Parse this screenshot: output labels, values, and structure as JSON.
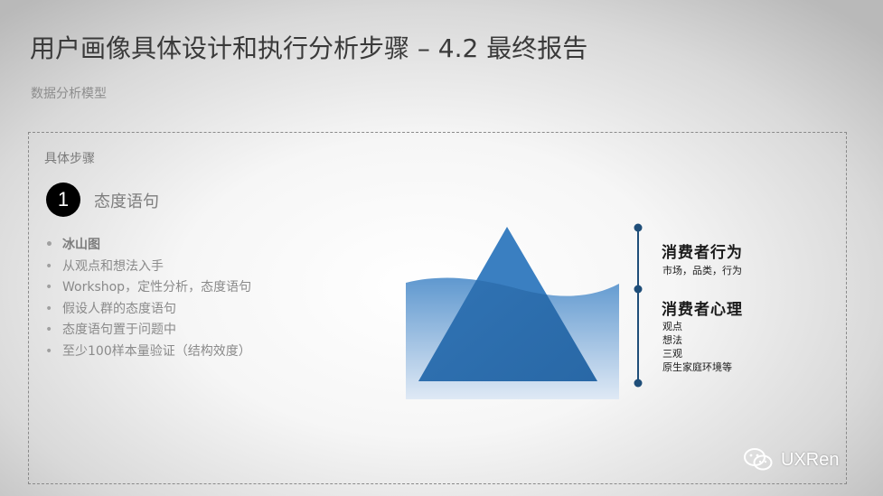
{
  "header": {
    "title": "用户画像具体设计和执行分析步骤 – 4.2 最终报告",
    "subtitle": "数据分析模型"
  },
  "panel": {
    "label": "具体步骤",
    "step": {
      "number": "1",
      "title": "态度语句"
    },
    "bullets": [
      "冰山图",
      "从观点和想法入手",
      "Workshop，定性分析，态度语句",
      "假设人群的态度语句",
      "态度语句置于问题中",
      "至少100样本量验证（结构效度）"
    ],
    "bullet_marker": "•"
  },
  "diagram": {
    "colors": {
      "water_top": "#5f98cf",
      "water_bottom": "#dfe9f5",
      "triangle": "#3a7fc1",
      "triangle_under": "#1f5d98",
      "line": "#1f4e79"
    },
    "behavior": {
      "heading": "消费者行为",
      "items": [
        "市场，品类，行为"
      ]
    },
    "psychology": {
      "heading": "消费者心理",
      "items": [
        "观点",
        "想法",
        "三观",
        "原生家庭环境等"
      ]
    }
  },
  "watermark": {
    "text": "UXRen",
    "icon": "wechat-icon"
  }
}
